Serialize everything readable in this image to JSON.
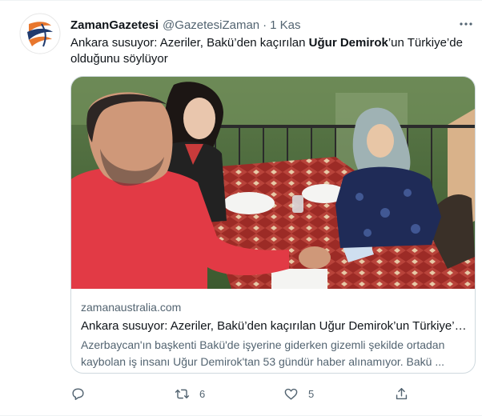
{
  "tweet": {
    "display_name": "ZamanGazetesi",
    "handle": "@GazetesiZaman",
    "separator": "·",
    "time": "1 Kas",
    "text_before": "Ankara susuyor: Azeriler, Bakü’den kaçırılan ",
    "text_bold": "Uğur Demirok",
    "text_after": "’un Türkiye’de olduğunu söylüyor"
  },
  "card": {
    "domain": "zamanaustralia.com",
    "title": "Ankara susuyor: Azeriler, Bakü’den kaçırılan Uğur Demirok’un Türkiye’de olduğunu söylüyor",
    "description": "Azerbaycan'ın başkenti Bakü'de işyerine giderken gizemli şekilde ortadan kaybolan iş insanı Uğur Demirok'tan 53 gündür haber alınamıyor. Bakü ..."
  },
  "actions": {
    "reply_count": "",
    "retweet_count": "6",
    "like_count": "5"
  },
  "icons": {
    "reply": "reply-icon",
    "retweet": "retweet-icon",
    "like": "heart-icon",
    "share": "share-icon",
    "more": "more-icon"
  },
  "colors": {
    "text_primary": "#0f1419",
    "text_secondary": "#536471",
    "border": "#cfd9de",
    "logo_orange": "#e8772e",
    "logo_navy": "#1f3a6e"
  }
}
